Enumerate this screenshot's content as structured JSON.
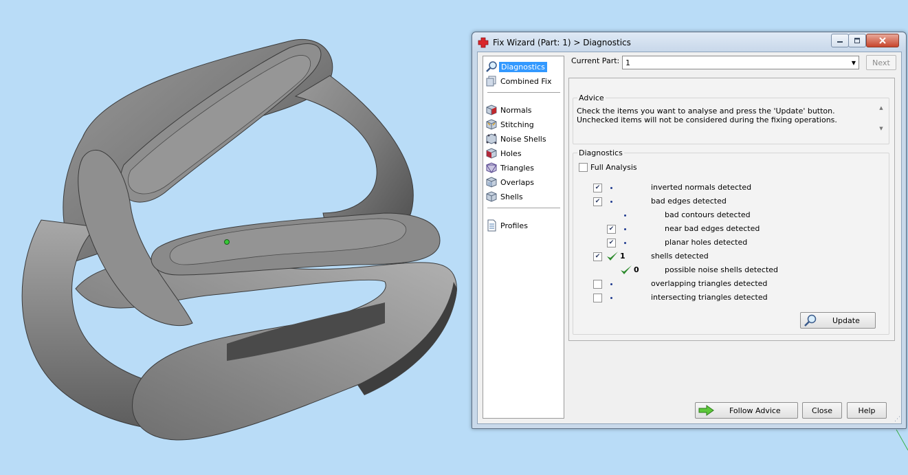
{
  "window": {
    "title": "Fix Wizard (Part: 1) > Diagnostics",
    "icon": "red-cross-icon"
  },
  "nav": {
    "items": [
      {
        "label": "Diagnostics",
        "icon": "magnifier-icon",
        "selected": true
      },
      {
        "label": "Combined Fix",
        "icon": "combined-fix-icon"
      },
      {
        "label": "Normals",
        "icon": "normals-cube-icon"
      },
      {
        "label": "Stitching",
        "icon": "stitching-cube-icon"
      },
      {
        "label": "Noise Shells",
        "icon": "noise-shells-cube-icon"
      },
      {
        "label": "Holes",
        "icon": "holes-cube-icon"
      },
      {
        "label": "Triangles",
        "icon": "triangles-cube-icon"
      },
      {
        "label": "Overlaps",
        "icon": "overlaps-cube-icon"
      },
      {
        "label": "Shells",
        "icon": "shells-cube-icon"
      },
      {
        "label": "Profiles",
        "icon": "document-icon"
      }
    ]
  },
  "current_part": {
    "label": "Current Part:",
    "value": "1"
  },
  "next_label": "Next",
  "advice": {
    "title": "Advice",
    "text": "Check the items you want to analyse and press the 'Update' button. Unchecked items will not be considered during the fixing operations."
  },
  "diagnostics": {
    "title": "Diagnostics",
    "full_analysis_label": "Full Analysis",
    "full_analysis_checked": false,
    "rows": [
      {
        "label": "inverted normals detected",
        "checked": true,
        "indent": 0
      },
      {
        "label": "bad edges detected",
        "checked": true,
        "indent": 0
      },
      {
        "label": "bad contours detected",
        "checked": null,
        "indent": 1
      },
      {
        "label": "near bad edges detected",
        "checked": true,
        "indent": 1
      },
      {
        "label": "planar holes detected",
        "checked": true,
        "indent": 1
      },
      {
        "label": "shells detected",
        "checked": true,
        "indent": 0,
        "status": "ok",
        "count": "1"
      },
      {
        "label": "possible noise shells detected",
        "checked": null,
        "indent": 1,
        "status": "ok",
        "count": "0"
      },
      {
        "label": "overlapping triangles detected",
        "checked": false,
        "indent": 0
      },
      {
        "label": "intersecting triangles detected",
        "checked": false,
        "indent": 0
      }
    ],
    "update_label": "Update"
  },
  "buttons": {
    "follow_advice": "Follow Advice",
    "close": "Close",
    "help": "Help"
  },
  "colors": {
    "background": "#b9dcf7",
    "model_gray": "#8a8a8a",
    "selection": "#3399ff",
    "check_green": "#2e8b2e"
  }
}
